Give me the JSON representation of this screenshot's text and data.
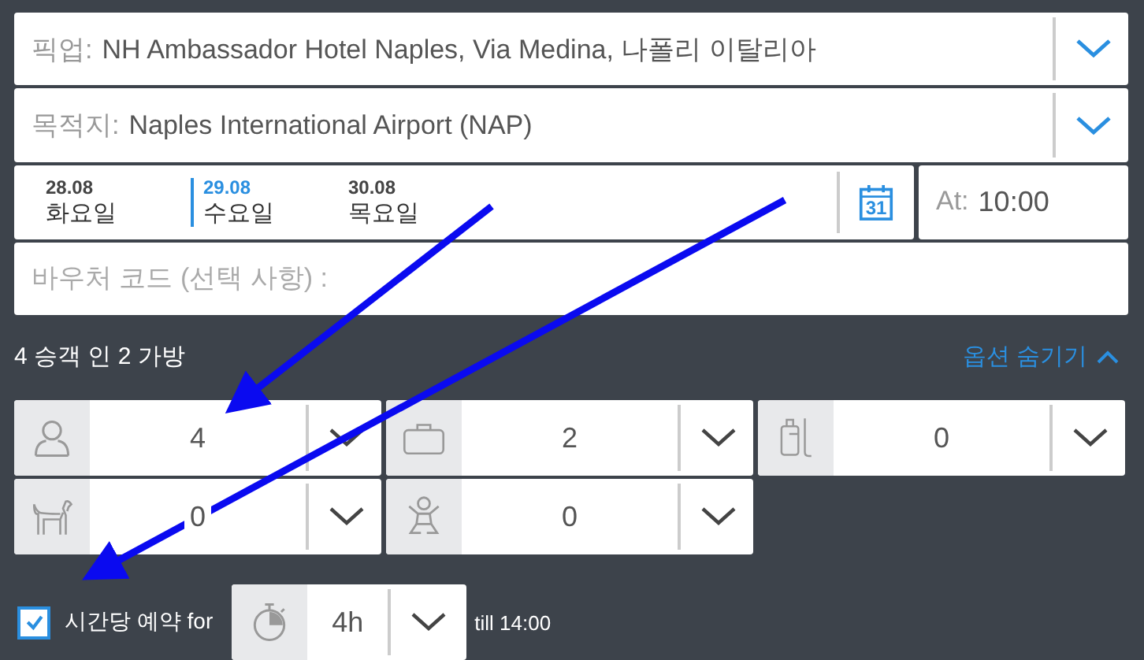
{
  "pickup": {
    "label": "픽업:",
    "value": "NH Ambassador Hotel Naples, Via Medina, 나폴리 이탈리아"
  },
  "destination": {
    "label": "목적지:",
    "value": "Naples International Airport (NAP)"
  },
  "dates": [
    {
      "date": "28.08",
      "day": "화요일",
      "selected": false
    },
    {
      "date": "29.08",
      "day": "수요일",
      "selected": true
    },
    {
      "date": "30.08",
      "day": "목요일",
      "selected": false
    }
  ],
  "calendar_day": "31",
  "time": {
    "label": "At:",
    "value": "10:00"
  },
  "voucher": {
    "placeholder": "바우처 코드 (선택 사항) :"
  },
  "summary": "4 승객 인 2 가방",
  "options_toggle": "옵션 숨기기",
  "selectors": [
    {
      "kind": "passengers",
      "value": "4"
    },
    {
      "kind": "luggage",
      "value": "2"
    },
    {
      "kind": "sports",
      "value": "0"
    },
    {
      "kind": "pet",
      "value": "0"
    },
    {
      "kind": "child",
      "value": "0"
    }
  ],
  "hourly": {
    "checked": true,
    "label": "시간당 예약 for",
    "duration": "4h",
    "till": "till 14:00"
  }
}
